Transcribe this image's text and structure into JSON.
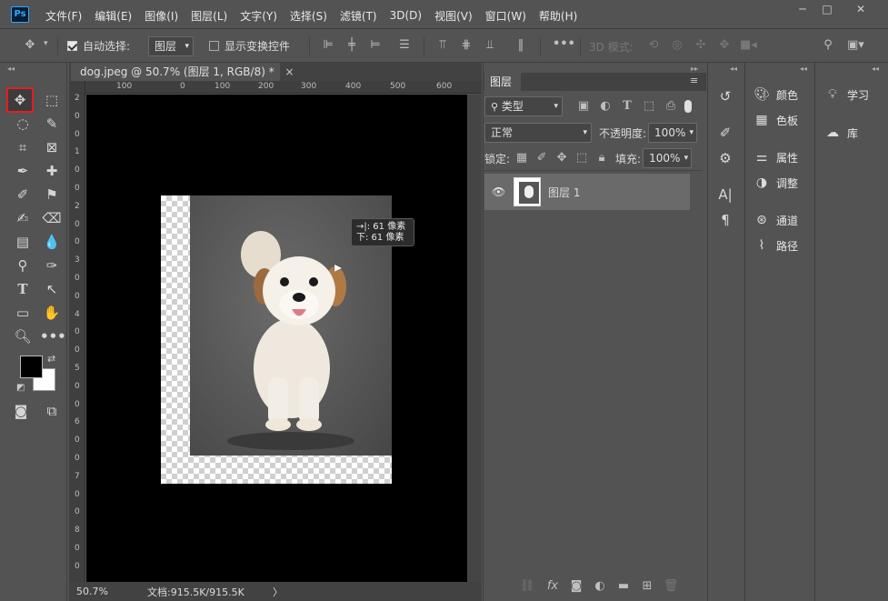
{
  "app": {
    "logo": "Ps"
  },
  "menu": [
    "文件(F)",
    "编辑(E)",
    "图像(I)",
    "图层(L)",
    "文字(Y)",
    "选择(S)",
    "滤镜(T)",
    "3D(D)",
    "视图(V)",
    "窗口(W)",
    "帮助(H)"
  ],
  "window_controls": {
    "minimize": "─",
    "restore": "□",
    "close": "✕"
  },
  "options": {
    "auto_select_label": "自动选择:",
    "auto_select_checked": true,
    "auto_select_target": "图层",
    "show_transform_label": "显示变换控件",
    "show_transform_checked": false,
    "mode_3d_label": "3D 模式:"
  },
  "document": {
    "tab_title": "dog.jpeg @ 50.7% (图层 1, RGB/8) *",
    "tab_close": "×",
    "ruler_h": [
      "100",
      "0",
      "100",
      "200",
      "300",
      "400",
      "500",
      "600"
    ],
    "ruler_v": [
      "2",
      "0",
      "0",
      "1",
      "0",
      "0",
      "2",
      "0",
      "0",
      "3",
      "0",
      "0",
      "4",
      "0",
      "0",
      "5",
      "0",
      "0",
      "6",
      "0",
      "0",
      "7",
      "0",
      "0",
      "8",
      "0",
      "0"
    ],
    "zoom": "50.7%",
    "doc_size": "文档:915.5K/915.5K",
    "status_arrow": "〉"
  },
  "tooltip": {
    "line1": "→|: 61 像素",
    "line2": "下: 61 像素"
  },
  "layers_panel": {
    "tab": "图层",
    "filter_type": "类型",
    "blend_mode": "正常",
    "opacity_label": "不透明度:",
    "opacity_value": "100%",
    "lock_label": "锁定:",
    "fill_label": "填充:",
    "fill_value": "100%",
    "layers": [
      {
        "name": "图层 1",
        "visible": true
      }
    ]
  },
  "dock_panels_1": [
    "颜色",
    "色板",
    "属性",
    "调整",
    "通道",
    "路径"
  ],
  "dock_panels_2": [
    "学习",
    "库"
  ]
}
